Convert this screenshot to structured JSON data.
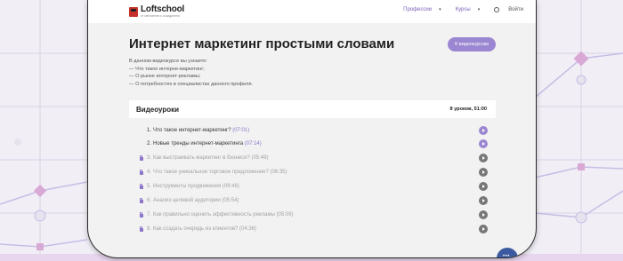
{
  "header": {
    "logo_name": "Loftschool",
    "logo_sub": "от мечтателя к созидателю",
    "nav": [
      {
        "label": "Профессии"
      },
      {
        "label": "Курсы"
      }
    ],
    "login": "Войти"
  },
  "course": {
    "title": "Интернет маркетинг простыми словами",
    "back_button": "К видеокурсам",
    "description": [
      "В данном видеокурсе вы узнаете:",
      "— Что такое интерне-маркетинг;",
      "— О рынке интернет-рекламы;",
      "— О потребностях в специалистах данного профиля."
    ]
  },
  "lessons_panel": {
    "heading": "Видеоуроки",
    "meta": "8 уроков, 51:00",
    "items": [
      {
        "num": "1.",
        "title": "Что такое интернет-маркетинг?",
        "duration": "(07:01)",
        "locked": false
      },
      {
        "num": "2.",
        "title": "Новые тренды интернет-маркетинга",
        "duration": "(07:14)",
        "locked": false
      },
      {
        "num": "3.",
        "title": "Как выстраивать маркетинг в бизнесе?",
        "duration": "(05:49)",
        "locked": true
      },
      {
        "num": "4.",
        "title": "Что такое уникальное торговое предложение?",
        "duration": "(06:35)",
        "locked": true
      },
      {
        "num": "5.",
        "title": "Инструменты продвижения",
        "duration": "(09:48)",
        "locked": true
      },
      {
        "num": "6.",
        "title": "Анализ целевой аудитории",
        "duration": "(05:54)",
        "locked": true
      },
      {
        "num": "7.",
        "title": "Как правильно оценить эффективность рекламы",
        "duration": "(05:09)",
        "locked": true
      },
      {
        "num": "8.",
        "title": "Как создать очередь из клиентов?",
        "duration": "(04:36)",
        "locked": true
      }
    ]
  },
  "colors": {
    "accent": "#9b87d1",
    "locked_text": "#a2a2a2",
    "play_locked": "#777777",
    "chat": "#3c5aa0"
  }
}
